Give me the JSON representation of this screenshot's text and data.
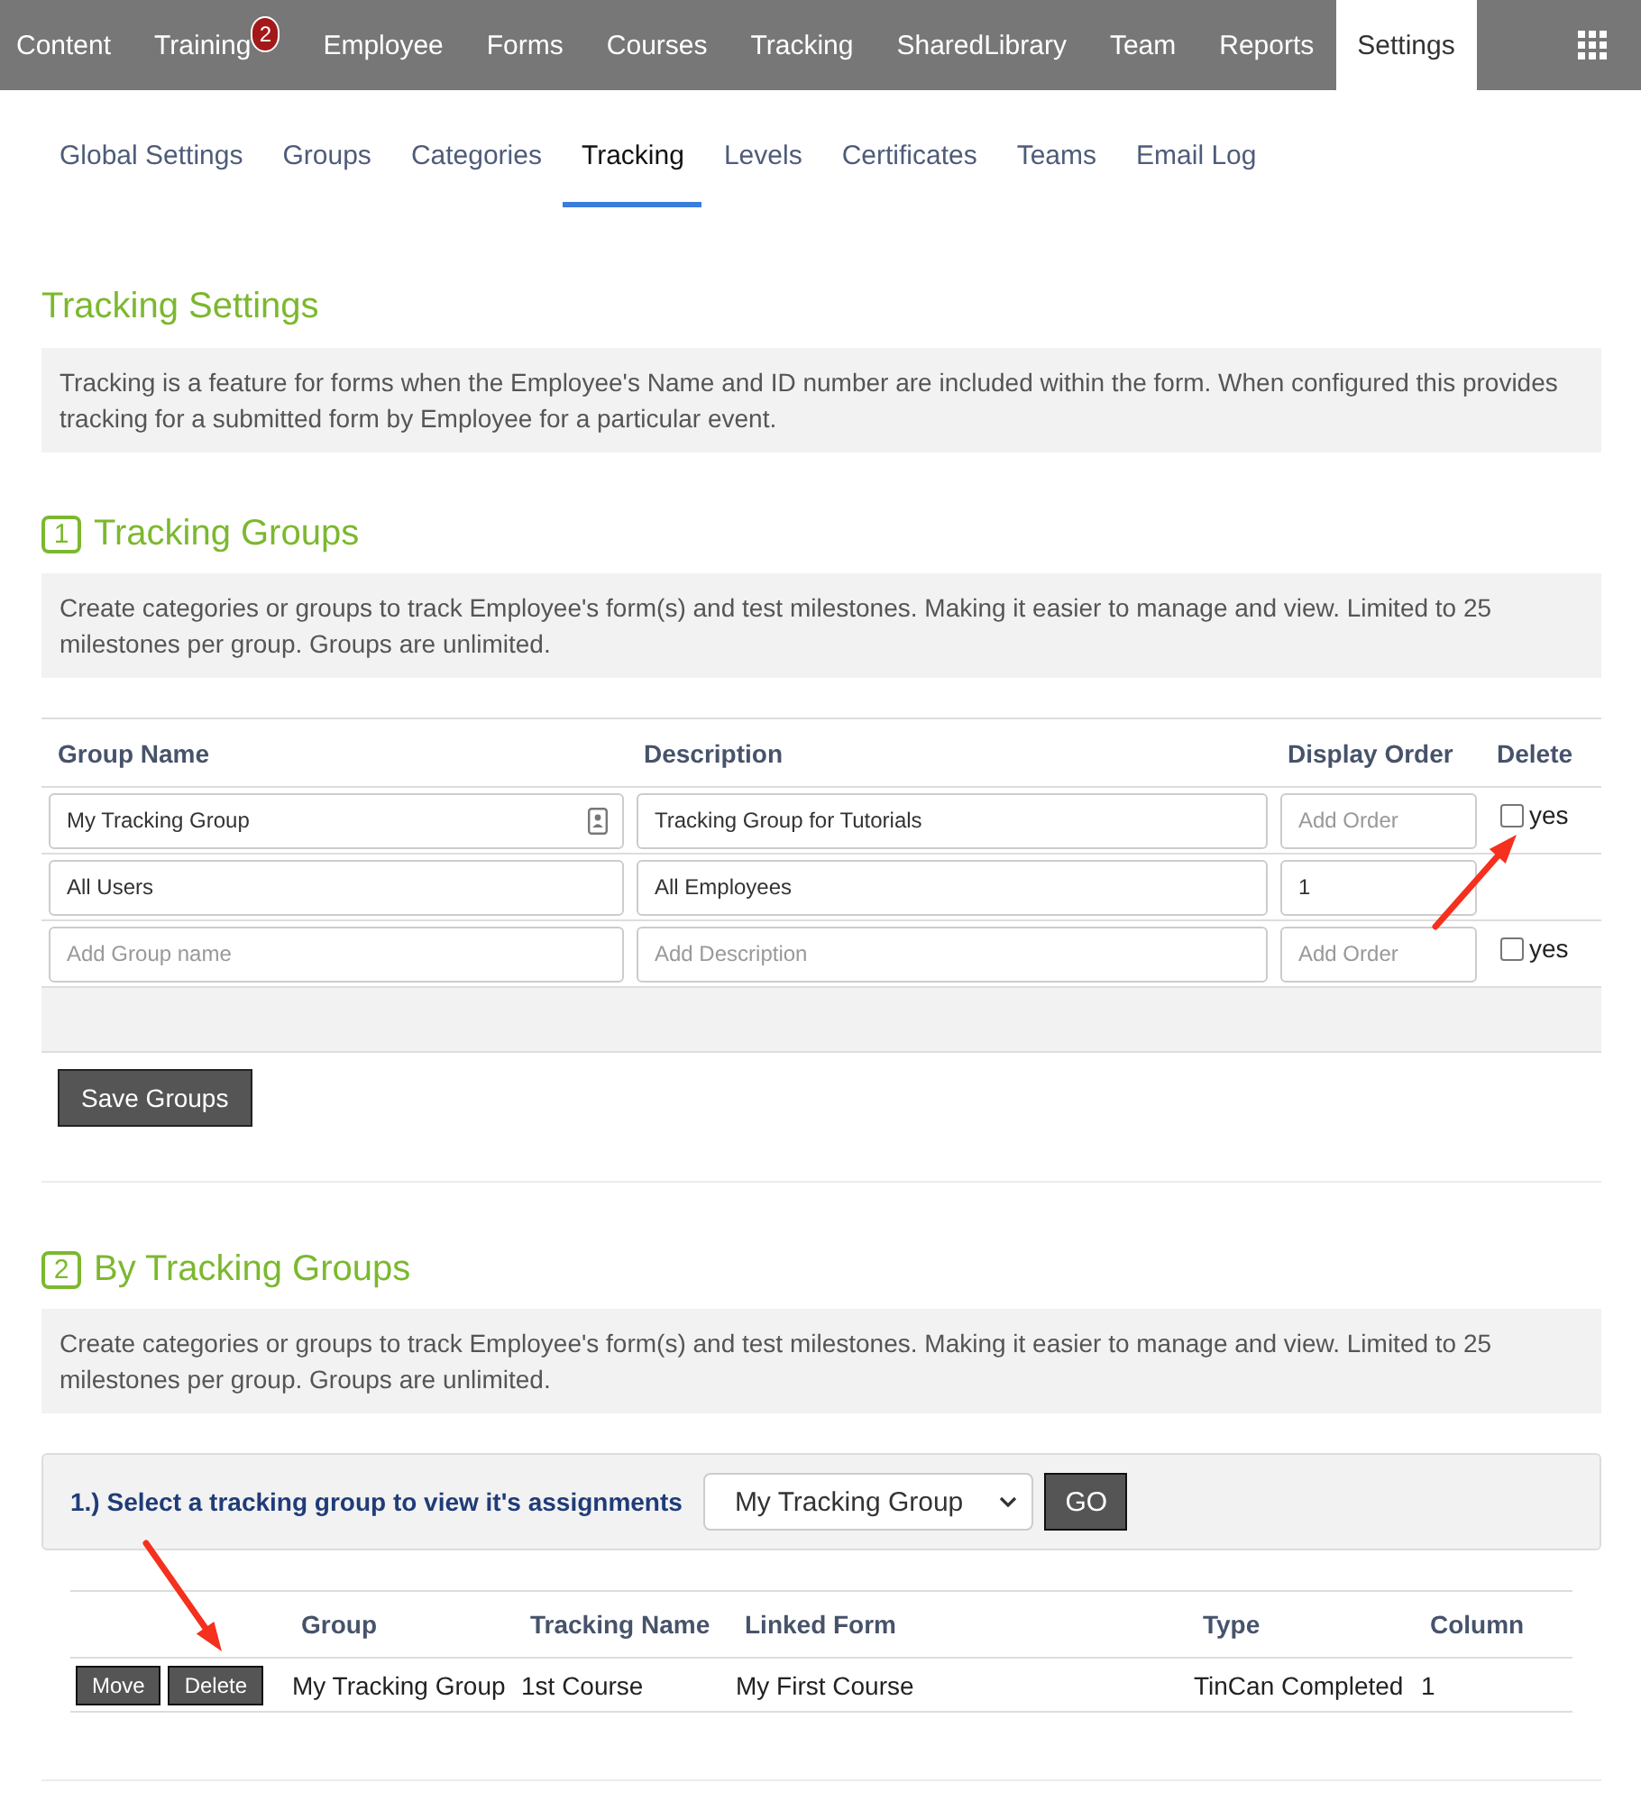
{
  "top_nav": {
    "items": [
      {
        "label": "Content",
        "selected": false
      },
      {
        "label": "Training",
        "selected": false,
        "badge": "2"
      },
      {
        "label": "Employee",
        "selected": false
      },
      {
        "label": "Forms",
        "selected": false
      },
      {
        "label": "Courses",
        "selected": false
      },
      {
        "label": "Tracking",
        "selected": false
      },
      {
        "label": "SharedLibrary",
        "selected": false
      },
      {
        "label": "Team",
        "selected": false
      },
      {
        "label": "Reports",
        "selected": false
      },
      {
        "label": "Settings",
        "selected": true
      }
    ]
  },
  "sub_tabs": [
    {
      "label": "Global Settings",
      "selected": false
    },
    {
      "label": "Groups",
      "selected": false
    },
    {
      "label": "Categories",
      "selected": false
    },
    {
      "label": "Tracking",
      "selected": true
    },
    {
      "label": "Levels",
      "selected": false
    },
    {
      "label": "Certificates",
      "selected": false
    },
    {
      "label": "Teams",
      "selected": false
    },
    {
      "label": "Email Log",
      "selected": false
    }
  ],
  "intro": {
    "title": "Tracking Settings",
    "description": "Tracking is a feature for forms when the Employee's Name and ID number are included within the form. When configured this provides tracking for a submitted form by Employee for a particular event."
  },
  "tracking_groups": {
    "number": "1",
    "title": "Tracking Groups",
    "description": "Create categories or groups to track Employee's form(s) and test milestones. Making it easier to manage and view. Limited to 25 milestones per group. Groups are unlimited.",
    "table": {
      "columns": [
        "Group Name",
        "Description",
        "Display Order",
        "Delete"
      ],
      "rows": [
        {
          "group_name": {
            "value": "My Tracking Group",
            "autofill": true
          },
          "description": {
            "value": "Tracking Group for Tutorials"
          },
          "display_order": {
            "placeholder": "Add Order"
          },
          "delete": {
            "checked": false,
            "label": "yes"
          }
        },
        {
          "group_name": {
            "value": "All Users",
            "autofill": false
          },
          "description": {
            "value": "All Employees"
          },
          "display_order": {
            "value": "1"
          }
        },
        {
          "group_name": {
            "placeholder": "Add Group name",
            "autofill": false
          },
          "description": {
            "placeholder": "Add Description"
          },
          "display_order": {
            "placeholder": "Add Order"
          },
          "delete": {
            "checked": false,
            "label": "yes"
          }
        }
      ]
    },
    "save_button": "Save Groups"
  },
  "by_tracking_groups": {
    "number": "2",
    "title": "By Tracking Groups",
    "description": "Create categories or groups to track Employee's form(s) and test milestones. Making it easier to manage and view. Limited to 25 milestones per group. Groups are unlimited.",
    "selector": {
      "label": "1.) Select a tracking group to view it's assignments",
      "value": "My Tracking Group",
      "button": "GO"
    },
    "table": {
      "columns": [
        "Group",
        "Tracking Name",
        "Linked Form",
        "Type",
        "Column"
      ],
      "rows": [
        {
          "actions": [
            "Move",
            "Delete"
          ],
          "cells": [
            "My Tracking Group",
            "1st Course",
            "My First Course",
            "TinCan Completed",
            "1"
          ]
        }
      ]
    }
  }
}
